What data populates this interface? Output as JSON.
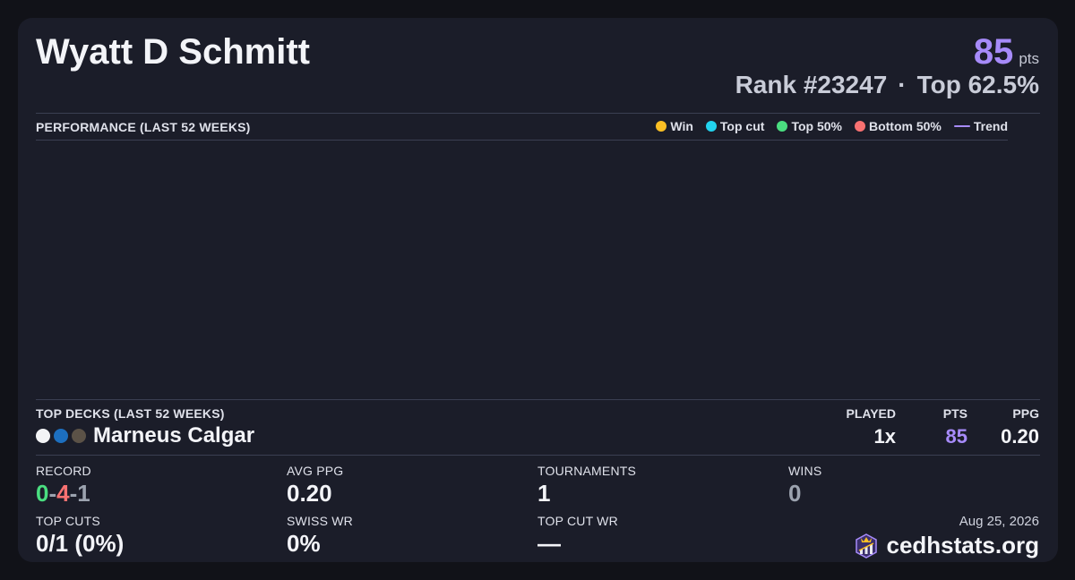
{
  "player": {
    "name": "Wyatt D Schmitt"
  },
  "score": {
    "points": "85",
    "points_unit": "pts",
    "rank": "Rank #23247",
    "separator": "·",
    "top_percent": "Top 62.5%"
  },
  "performance": {
    "title": "PERFORMANCE (LAST 52 WEEKS)",
    "legend": [
      {
        "label": "Win",
        "color": "#fbbf24"
      },
      {
        "label": "Top cut",
        "color": "#22d3ee"
      },
      {
        "label": "Top 50%",
        "color": "#4ade80"
      },
      {
        "label": "Bottom 50%",
        "color": "#f87171"
      },
      {
        "label": "Trend",
        "color": "#a78bfa"
      }
    ]
  },
  "top_decks": {
    "title": "TOP DECKS (LAST 52 WEEKS)",
    "columns": {
      "played": "PLAYED",
      "pts": "PTS",
      "ppg": "PPG"
    },
    "decks": [
      {
        "name": "Marneus Calgar",
        "colors": [
          "#f3f4f6",
          "#1d6fbf",
          "#5b5247"
        ],
        "played": "1x",
        "pts": "85",
        "ppg": "0.20"
      }
    ]
  },
  "stats": {
    "record_label": "RECORD",
    "record_wins": "0",
    "record_losses": "4",
    "record_draws": "1",
    "record_sep": "-",
    "avg_ppg_label": "AVG PPG",
    "avg_ppg": "0.20",
    "tournaments_label": "TOURNAMENTS",
    "tournaments": "1",
    "wins_label": "WINS",
    "wins": "0",
    "top_cuts_label": "TOP CUTS",
    "top_cuts": "0/1 (0%)",
    "swiss_wr_label": "SWISS WR",
    "swiss_wr": "0%",
    "top_cut_wr_label": "TOP CUT WR",
    "top_cut_wr": "—"
  },
  "footer": {
    "date": "Aug 25, 2026",
    "brand": "cedhstats.org"
  },
  "colors": {
    "accent": "#a78bfa",
    "win": "#4ade80",
    "loss": "#f87171",
    "draw": "#9ca3af",
    "muted_value": "#9ca3af"
  }
}
